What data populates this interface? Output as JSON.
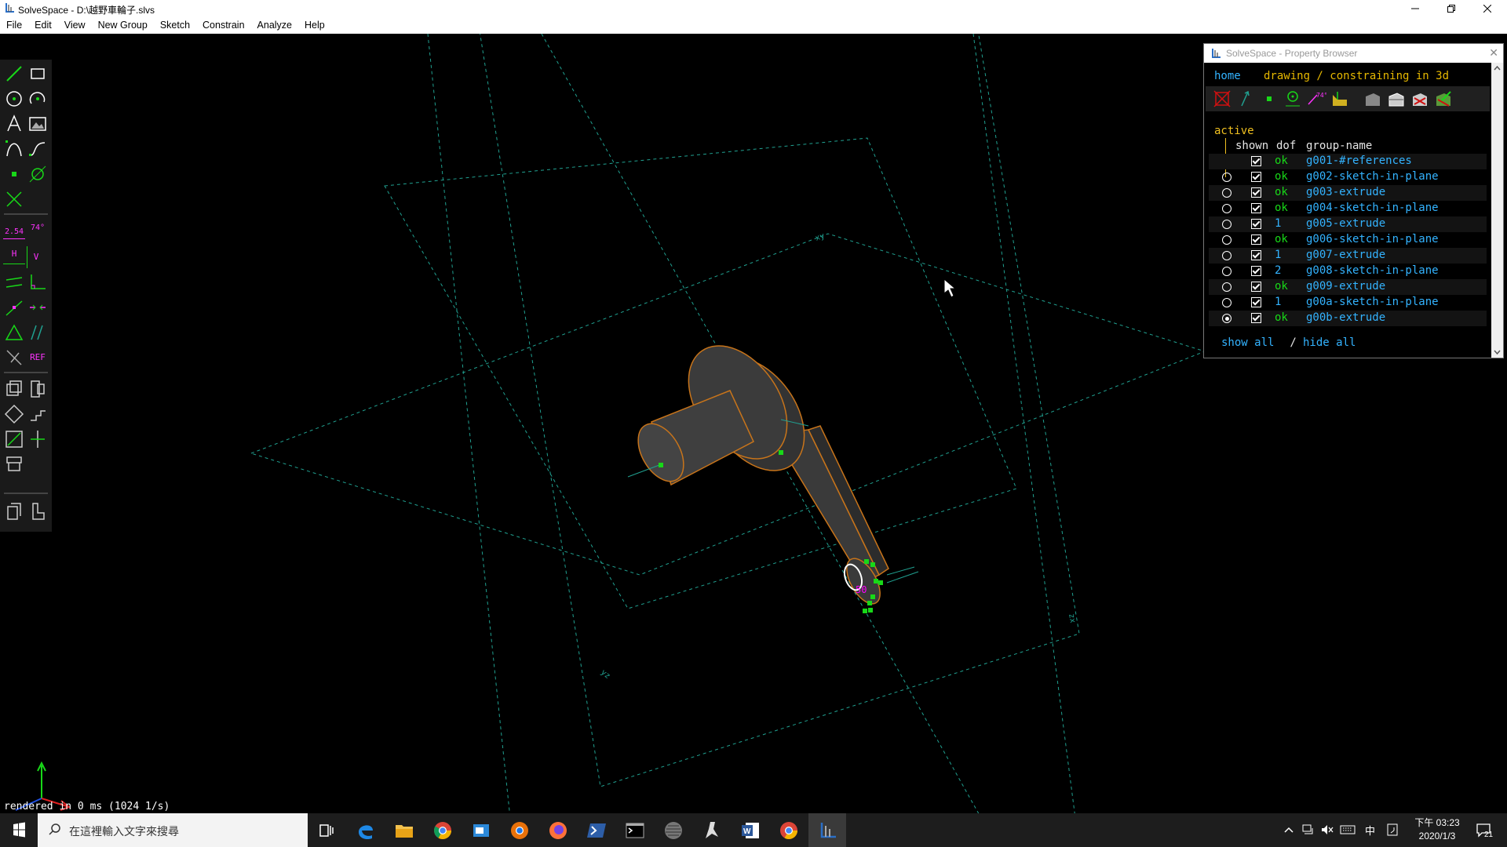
{
  "window": {
    "title": "SolveSpace - D:\\越野車輪子.slvs"
  },
  "menu": [
    "File",
    "Edit",
    "View",
    "New Group",
    "Sketch",
    "Constrain",
    "Analyze",
    "Help"
  ],
  "status": "rendered in 0 ms (1024 1/s)",
  "toolbar": {
    "tools": [
      "line-tool",
      "rectangle-tool",
      "circle-tool",
      "arc-tool",
      "text-tool",
      "image-tool",
      "bezier-tool",
      "spline-tool",
      "point-tool",
      "workplane-tool",
      "construction-tool",
      "distance-constraint",
      "angle-constraint",
      "horizontal-constraint",
      "vertical-constraint",
      "parallel-constraint",
      "perpendicular-constraint",
      "pt-on-line-constraint",
      "symmetric-constraint",
      "equal-constraint",
      "same-orientation-constraint",
      "other-supplementary",
      "reference-toggle",
      "step-rotate",
      "step-translate",
      "extrude-group",
      "lathe-group",
      "revolve-group",
      "helix-group",
      "linking-group",
      "nearest-iso-view",
      "nearest-ortho-view"
    ],
    "distance_label": "2.54",
    "angle_label": "74°",
    "horizontal_label": "H",
    "vertical_label": "V",
    "ref_label": "REF"
  },
  "property_browser": {
    "title": "SolveSpace - Property Browser",
    "home": "home",
    "mode": "drawing / constraining in 3d",
    "active_label": "active",
    "columns": {
      "shown": "shown",
      "dof": "dof",
      "name": "group-name"
    },
    "groups": [
      {
        "radio": false,
        "selected": false,
        "dof": "ok",
        "name": "g001-#references"
      },
      {
        "radio": true,
        "selected": false,
        "dof": "ok",
        "name": "g002-sketch-in-plane"
      },
      {
        "radio": true,
        "selected": false,
        "dof": "ok",
        "name": "g003-extrude"
      },
      {
        "radio": true,
        "selected": false,
        "dof": "ok",
        "name": "g004-sketch-in-plane"
      },
      {
        "radio": true,
        "selected": false,
        "dof": "1",
        "name": "g005-extrude"
      },
      {
        "radio": true,
        "selected": false,
        "dof": "ok",
        "name": "g006-sketch-in-plane"
      },
      {
        "radio": true,
        "selected": false,
        "dof": "1",
        "name": "g007-extrude"
      },
      {
        "radio": true,
        "selected": false,
        "dof": "2",
        "name": "g008-sketch-in-plane"
      },
      {
        "radio": true,
        "selected": false,
        "dof": "ok",
        "name": "g009-extrude"
      },
      {
        "radio": true,
        "selected": false,
        "dof": "1",
        "name": "g00a-sketch-in-plane"
      },
      {
        "radio": true,
        "selected": true,
        "dof": "ok",
        "name": "g00b-extrude"
      }
    ],
    "show_all": "show all",
    "sep": " / ",
    "hide_all": "hide all"
  },
  "taskbar": {
    "search_placeholder": "在這裡輸入文字來搜尋",
    "apps": [
      "task-view",
      "edge",
      "file-explorer",
      "chrome",
      "mail",
      "chrome-canary",
      "firefox",
      "powershell",
      "terminal",
      "app-gray",
      "inkscape",
      "word",
      "chrome-2",
      "solvespace"
    ],
    "ime": "中",
    "time": "下午 03:23",
    "date": "2020/1/3",
    "notifications": "21"
  },
  "colors": {
    "group_name": "#33b3ff",
    "ok": "#18d818",
    "dof_number": "#33b3ff",
    "active": "#f0c020",
    "mode_text": "#e6b800",
    "model_face": "#3a3a3a",
    "model_edge": "#c8741a",
    "construction": "#20a090",
    "point": "#18d818",
    "constraint": "#ff00ff"
  }
}
